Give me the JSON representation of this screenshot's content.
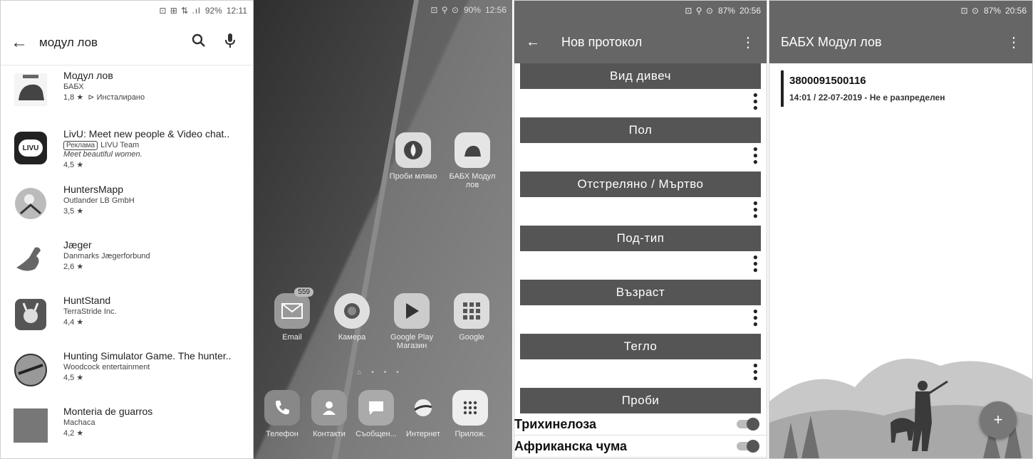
{
  "panel1": {
    "status": {
      "icons": "⊡ ⊞ ⇅ .ıl",
      "battery": "92%",
      "time": "12:11"
    },
    "search": {
      "query": "модул лов"
    },
    "results": [
      {
        "title": "Модул лов",
        "dev": "БАБХ",
        "rating": "1,8 ★",
        "installed": "Инсталирано"
      },
      {
        "title": "LivU: Meet new people & Video chat..",
        "ad_label": "Реклама",
        "dev": "LIVU Team",
        "tagline": "Meet beautiful women.",
        "rating": "4,5 ★"
      },
      {
        "title": "HuntersMapp",
        "dev": "Outlander LB GmbH",
        "rating": "3,5 ★"
      },
      {
        "title": "Jæger",
        "dev": "Danmarks Jægerforbund",
        "rating": "2,6 ★"
      },
      {
        "title": "HuntStand",
        "dev": "TerraStride Inc.",
        "rating": "4,4 ★"
      },
      {
        "title": "Hunting Simulator Game. The hunter..",
        "dev": "Woodcock entertainment",
        "rating": "4,5 ★"
      },
      {
        "title": "Monteria de guarros",
        "dev": "Machaca",
        "rating": "4,2 ★"
      }
    ],
    "livu_icon_text": "LIVU"
  },
  "panel2": {
    "status": {
      "icons": "⊡ ⚲ ⊙",
      "battery": "90%",
      "time": "12:56"
    },
    "apps": {
      "probi": "Проби мляко",
      "babh": "БАБХ Модул лов",
      "email": "Email",
      "email_badge": "559",
      "camera": "Камера",
      "play": "Google Play Магазин",
      "google": "Google",
      "phone": "Телефон",
      "contacts": "Контакти",
      "messages": "Съобщен...",
      "internet": "Интернет",
      "apps": "Прилож."
    }
  },
  "panel3": {
    "status": {
      "icons": "⊡ ⚲ ⊙",
      "battery": "87%",
      "time": "20:56"
    },
    "title": "Нов протокол",
    "fields": [
      "Вид дивеч",
      "Пол",
      "Отстреляно / Мъртво",
      "Под-тип",
      "Възраст",
      "Тегло",
      "Проби"
    ],
    "toggles": [
      "Трихинелоза",
      "Африканска чума"
    ]
  },
  "panel4": {
    "status": {
      "icons": "⊡ ⊙",
      "battery": "87%",
      "time": "20:56"
    },
    "title": "БАБХ Модул лов",
    "item": {
      "id": "3800091500116",
      "subtitle": "14:01 / 22-07-2019 - Не е разпределен"
    },
    "fab_symbol": "+"
  }
}
